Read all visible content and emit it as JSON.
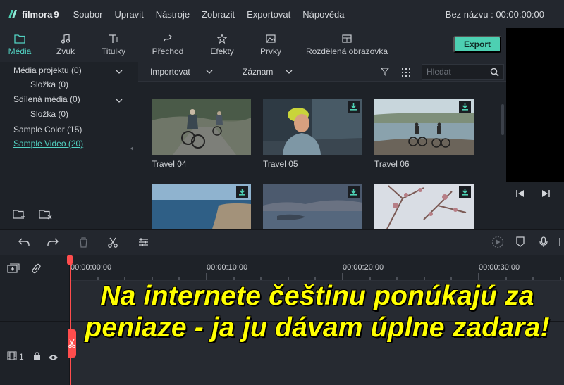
{
  "app": {
    "logo_text": "filmora",
    "logo_version": "9",
    "project_title": "Bez názvu : 00:00:00:00"
  },
  "menu": [
    "Soubor",
    "Upravit",
    "Nástroje",
    "Zobrazit",
    "Exportovat",
    "Nápověda"
  ],
  "tabs": [
    {
      "label": "Média",
      "icon": "folder-icon",
      "active": true
    },
    {
      "label": "Zvuk",
      "icon": "music-note-icon"
    },
    {
      "label": "Titulky",
      "icon": "text-icon"
    },
    {
      "label": "Přechod",
      "icon": "transition-icon"
    },
    {
      "label": "Efekty",
      "icon": "effects-icon"
    },
    {
      "label": "Prvky",
      "icon": "image-icon"
    },
    {
      "label": "Rozdělená obrazovka",
      "icon": "split-screen-icon"
    }
  ],
  "export_label": "Export",
  "sidebar": {
    "items": [
      {
        "label": "Média projektu (0)"
      },
      {
        "label": "Složka (0)"
      },
      {
        "label": "Sdílená média (0)"
      },
      {
        "label": "Složka (0)"
      },
      {
        "label": "Sample Color (15)"
      },
      {
        "label": "Sample Video (20)",
        "selected": true
      }
    ]
  },
  "content_toolbar": {
    "import_label": "Importovat",
    "record_label": "Záznam",
    "search_placeholder": "Hledat"
  },
  "media": [
    {
      "label": "Travel 04",
      "download": false
    },
    {
      "label": "Travel 05",
      "download": true
    },
    {
      "label": "Travel 06",
      "download": true
    },
    {
      "label": "",
      "download": true
    },
    {
      "label": "",
      "download": true
    },
    {
      "label": "",
      "download": true
    }
  ],
  "timeline": {
    "ticks": [
      "00:00:00:00",
      "00:00:10:00",
      "00:00:20:00",
      "00:00:30:00"
    ],
    "track_number": "1"
  },
  "overlay_text": "Na internete češtinu ponúkajú za peniaze - ja ju dávam úplne zadara!",
  "colors": {
    "accent": "#52d3c3",
    "export_button": "#4dd0b2",
    "playhead": "#ff4d4d",
    "overlay_text": "#ffff00"
  }
}
